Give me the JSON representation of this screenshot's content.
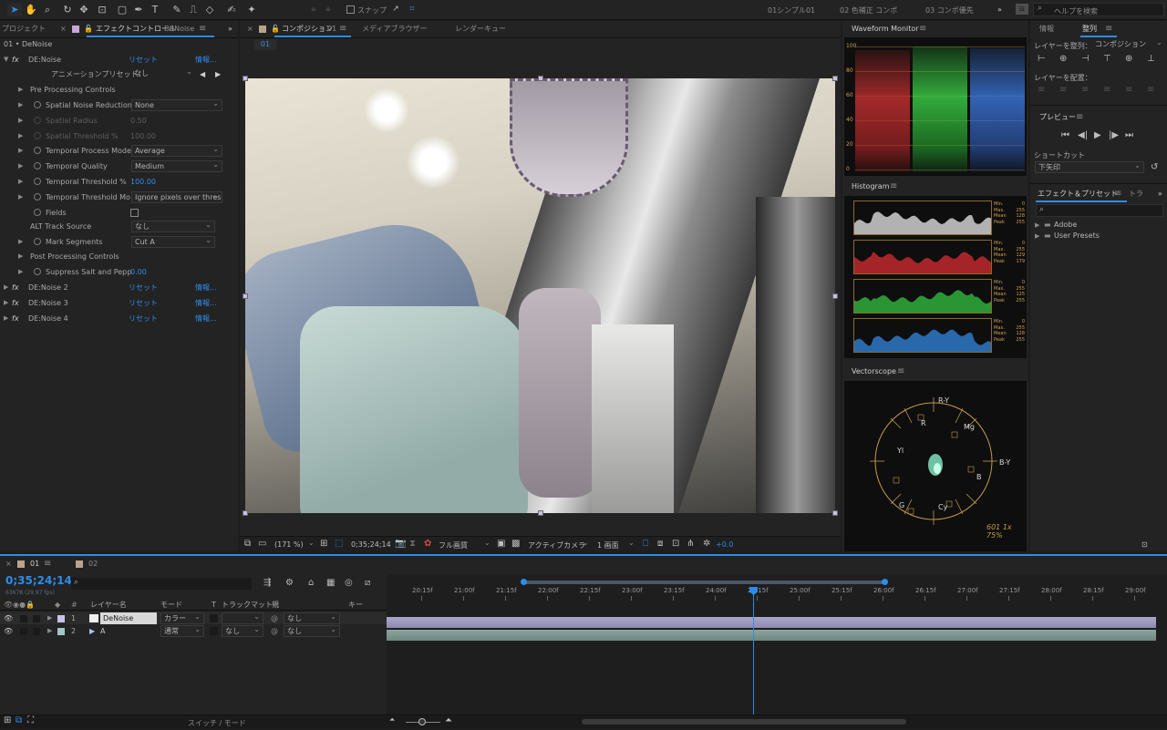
{
  "toolbar": {
    "snap_label": "スナップ",
    "workspaces": [
      "01シンプル01",
      "02 色補正 コンポ",
      "03 コンポ優先"
    ],
    "search_placeholder": "ヘルプを検索"
  },
  "project_panel": {
    "tab_project": "プロジェクト",
    "tab_effects_control": "エフェクトコントロール",
    "tab_effects_target": "DeNoise",
    "breadcrumb": "01 • DeNoise",
    "effect": {
      "name": "DE:Noise",
      "reset": "リセット",
      "info": "情報...",
      "preset_label": "アニメーションプリセット：",
      "preset_value": "なし",
      "group_pre": "Pre Processing Controls",
      "params": [
        {
          "label": "Spatial Noise Reduction",
          "value": "None",
          "type": "dropdown"
        },
        {
          "label": "Spatial Radius",
          "value": "0.50",
          "type": "dim"
        },
        {
          "label": "Spatial Threshold %",
          "value": "100.00",
          "type": "dim"
        },
        {
          "label": "Temporal Process Mode",
          "value": "Average",
          "type": "dropdown"
        },
        {
          "label": "Temporal Quality",
          "value": "Medium",
          "type": "dropdown"
        },
        {
          "label": "Temporal Threshold %",
          "value": "100.00",
          "type": "number"
        },
        {
          "label": "Temporal Threshold Mo",
          "value": "Ignore pixels over thres",
          "type": "dropdown"
        },
        {
          "label": "Fields",
          "value": "",
          "type": "checkbox"
        }
      ],
      "alt_track_label": "ALT Track Source",
      "alt_track_value": "なし",
      "mark_segments_label": "Mark Segments",
      "mark_segments_value": "Cut A",
      "group_post": "Post Processing Controls",
      "suppress_label": "Suppress Salt and Pepp",
      "suppress_value": "0.00"
    },
    "other_effects": [
      {
        "name": "DE:Noise 2",
        "reset": "リセット",
        "info": "情報..."
      },
      {
        "name": "DE:Noise 3",
        "reset": "リセット",
        "info": "情報..."
      },
      {
        "name": "DE:Noise 4",
        "reset": "リセット",
        "info": "情報..."
      }
    ]
  },
  "composition_panel": {
    "tab_comp": "コンポジション",
    "tab_comp_name": "01",
    "tab_media": "メディアブラウザー",
    "tab_render": "レンダーキュー",
    "comp_chip": "01",
    "zoom": "(171 %)",
    "timecode": "0;35;24;14",
    "quality": "フル画質",
    "camera": "アクティブカメラ",
    "views": "1 画面",
    "exposure": "+0.0"
  },
  "scopes": {
    "waveform_title": "Waveform Monitor",
    "waveform_ticks": [
      "100",
      "80",
      "60",
      "40",
      "20",
      "0"
    ],
    "histogram_title": "Histogram",
    "histograms": [
      {
        "color": "#cfcfcf",
        "min": "0",
        "max": "255",
        "mean": "128",
        "peak": "255"
      },
      {
        "color": "#c0282c",
        "min": "0",
        "max": "255",
        "mean": "129",
        "peak": "179"
      },
      {
        "color": "#2fae3a",
        "min": "0",
        "max": "255",
        "mean": "125",
        "peak": "255"
      },
      {
        "color": "#2f78c8",
        "min": "0",
        "max": "255",
        "mean": "128",
        "peak": "255"
      }
    ],
    "vectorscope_title": "Vectorscope",
    "vector_labels": {
      "ry": "R-Y",
      "r": "R",
      "mg": "Mg",
      "by": "B-Y",
      "b": "B",
      "yl": "Yl",
      "g": "G",
      "cy": "Cy"
    },
    "vector_note": "601 1x 75%"
  },
  "right_panel": {
    "tab_info": "情報",
    "tab_align": "整列",
    "align_label": "レイヤーを整列：",
    "align_target": "コンポジション",
    "distribute_label": "レイヤーを配置：",
    "preview_title": "プレビュー",
    "shortcut_label": "ショートカット",
    "shortcut_value": "下矢印",
    "fx_tab": "エフェクト＆プリセット",
    "fx_tab2": "トラ",
    "fx_items": [
      "Adobe",
      "User Presets"
    ]
  },
  "timeline": {
    "tab_01": "01",
    "tab_02": "02",
    "timecode": "0;35;24;14",
    "frame_info": "63678 (29.97 fps)",
    "col_name": "レイヤー名",
    "col_mode": "モード",
    "col_t": "T",
    "col_trkmat": "トラックマット",
    "col_parent": "親",
    "col_key": "キー",
    "layers": [
      {
        "num": "1",
        "name": "DeNoise",
        "mode": "カラー",
        "trkmat": "",
        "parent": "なし"
      },
      {
        "num": "2",
        "name": "A",
        "mode": "通常",
        "trkmat": "なし",
        "parent": "なし"
      }
    ],
    "ruler": [
      "20:15f",
      "21:00f",
      "21:15f",
      "22:00f",
      "22:15f",
      "23:00f",
      "23:15f",
      "24:00f",
      "24:15f",
      "25:00f",
      "25:15f",
      "26:00f",
      "26:15f",
      "27:00f",
      "27:15f",
      "28:00f",
      "28:15f",
      "29:00f"
    ],
    "switch_mode": "スイッチ / モード"
  }
}
